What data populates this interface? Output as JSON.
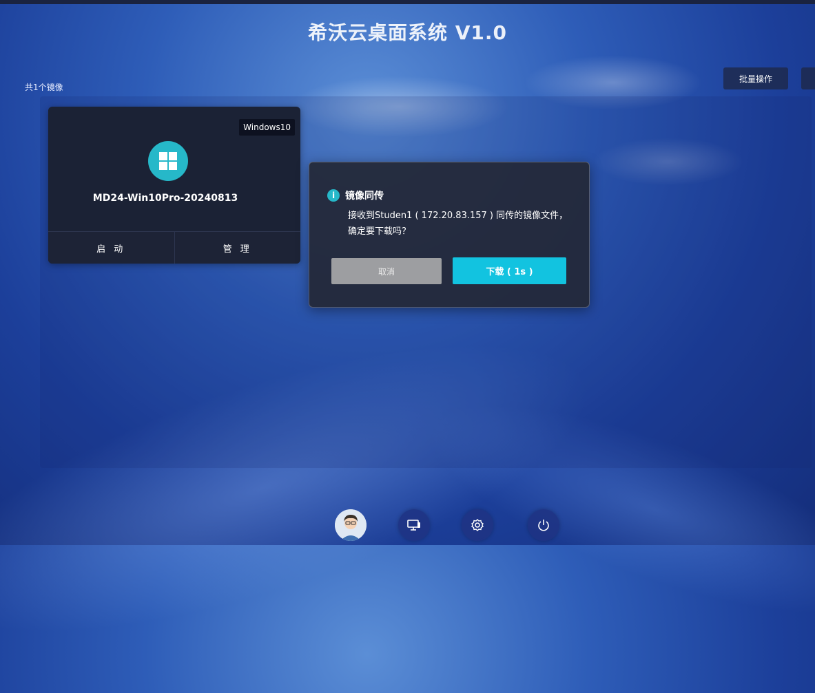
{
  "window": {
    "title": "希沃云桌面系统 V1.0"
  },
  "images": {
    "count_label": "共1个镜像",
    "batch_label": "批量操作",
    "items": [
      {
        "os": "Windows10",
        "os_icon": "windows-icon",
        "name": "MD24-Win10Pro-20240813",
        "start_label": "启 动",
        "manage_label": "管 理"
      }
    ]
  },
  "dialog": {
    "icon": "info-icon",
    "icon_glyph": "i",
    "title": "镜像同传",
    "message": "接收到Studen1 ( 172.20.83.157 ) 同传的镜像文件，确定要下载吗？",
    "cancel_label": "取消",
    "download_label": "下载 ( 1s )"
  },
  "dock": {
    "items": [
      "avatar",
      "desktop-monitor-icon",
      "settings-icon",
      "power-icon"
    ]
  },
  "colors": {
    "accent": "#12c3e0",
    "card_bg": "#1b2235",
    "dialog_bg": "#23283a",
    "cancel_bg": "#9d9ea1",
    "background": "#2e5db8"
  }
}
